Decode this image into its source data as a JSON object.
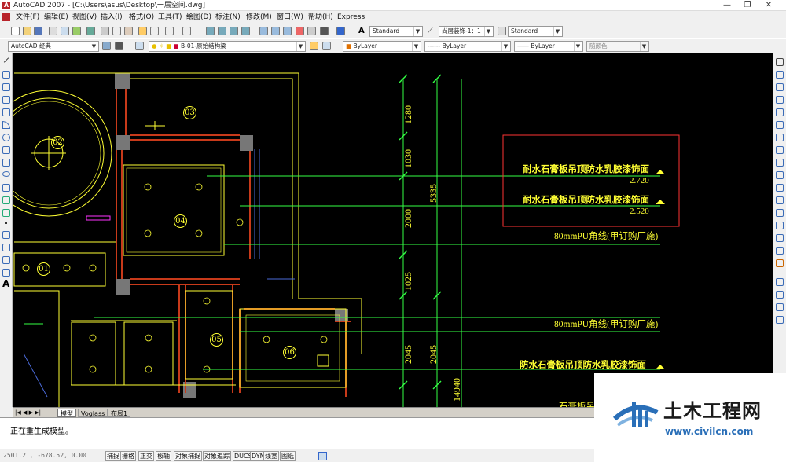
{
  "window": {
    "title": "AutoCAD 2007 - [C:\\Users\\asus\\Desktop\\一层空间.dwg]",
    "controls": [
      "—",
      "❐",
      "✕"
    ]
  },
  "menu": [
    "文件(F)",
    "编辑(E)",
    "视图(V)",
    "插入(I)",
    "格式(O)",
    "工具(T)",
    "绘图(D)",
    "标注(N)",
    "修改(M)",
    "窗口(W)",
    "帮助(H)",
    "Express"
  ],
  "toolbar1": {
    "text_style": "Standard",
    "dim_style": "尚层装饰-1：1",
    "table_style": "Standard"
  },
  "toolbar2": {
    "workspace": "AutoCAD 经典",
    "layer": "B-01-原始结构梁",
    "color": "ByLayer",
    "linetype": "ByLayer",
    "lineweight": "ByLayer",
    "plotstyle": "随颜色"
  },
  "drawing": {
    "room_numbers": [
      "01",
      "02",
      "03",
      "04",
      "05",
      "06"
    ],
    "dimensions_left": [
      "1280",
      "1030",
      "2000",
      "1025",
      "2045"
    ],
    "dimensions_mid": [
      "5335",
      "2045"
    ],
    "dimension_bottom": "14940",
    "annotations": [
      {
        "text": "耐水石膏板吊顶防水乳胶漆饰面",
        "level": "2.720"
      },
      {
        "text": "耐水石膏板吊顶防水乳胶漆饰面",
        "level": "2.520"
      },
      {
        "text": "80mmPU角线(甲订购厂施)",
        "level": ""
      },
      {
        "text": "80mmPU角线(甲订购厂施)",
        "level": ""
      },
      {
        "text": "防水石膏板吊顶防水乳胶漆饰面",
        "level": ""
      },
      {
        "text": "石膏板吊",
        "level": ""
      }
    ]
  },
  "layout_tabs": [
    "模型",
    "Voglass",
    "布局1"
  ],
  "command_line": "正在重生成模型。",
  "status": {
    "coords": "2501.21, -678.52, 0.00",
    "buttons": [
      "捕捉",
      "栅格",
      "正交",
      "极轴",
      "对象捕捉",
      "对象追踪",
      "DUCS",
      "DYN",
      "线宽",
      "图纸"
    ]
  },
  "watermark": {
    "title": "土木工程网",
    "url": "www.civilcn.com"
  },
  "colors": {
    "canvas_bg": "#000000",
    "yellow": "#ffff33",
    "green": "#33ff44",
    "red": "#ff3333",
    "wall_red": "#c83a1a"
  }
}
